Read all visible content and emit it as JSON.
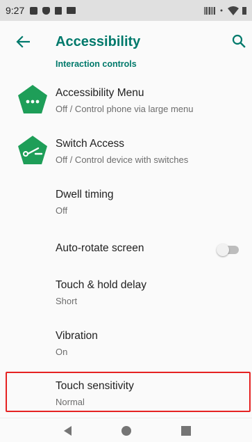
{
  "status_bar": {
    "time": "9:27"
  },
  "toolbar": {
    "title": "Accessibility"
  },
  "section": {
    "header": "Interaction controls"
  },
  "items": [
    {
      "title": "Accessibility Menu",
      "subtitle": "Off / Control phone via large menu",
      "icon": "accessibility-menu-icon"
    },
    {
      "title": "Switch Access",
      "subtitle": "Off / Control device with switches",
      "icon": "switch-access-icon"
    },
    {
      "title": "Dwell timing",
      "subtitle": "Off"
    },
    {
      "title": "Auto-rotate screen",
      "toggle_on": false
    },
    {
      "title": "Touch & hold delay",
      "subtitle": "Short"
    },
    {
      "title": "Vibration",
      "subtitle": "On"
    },
    {
      "title": "Touch sensitivity",
      "subtitle": "Normal"
    }
  ],
  "colors": {
    "accent": "#00796b",
    "icon_green": "#1e9e58",
    "highlight": "#e52222"
  }
}
